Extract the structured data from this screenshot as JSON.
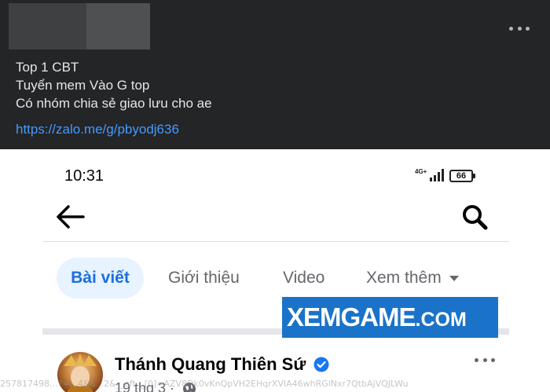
{
  "post": {
    "lines": [
      "Top 1 CBT",
      "Tuyển mem Vào G top",
      "Có nhóm chia sẻ giao lưu cho ae"
    ],
    "link": "https://zalo.me/g/pbyodj636",
    "avatar_state": "blurred",
    "more_icon": "more-horizontal-icon"
  },
  "phone": {
    "status": {
      "time": "10:31",
      "network": "4G+",
      "battery": "66"
    },
    "nav": {
      "back_icon": "back-arrow-icon",
      "search_icon": "search-icon"
    },
    "tabs": [
      {
        "label": "Bài viết",
        "active": true
      },
      {
        "label": "Giới thiệu",
        "active": false
      },
      {
        "label": "Video",
        "active": false
      },
      {
        "label": "Xem thêm",
        "active": false
      }
    ],
    "page": {
      "name": "Thánh Quang Thiên Sứ",
      "verified": true,
      "date": "19 thg 3 ·",
      "audience_icon": "globe-icon"
    }
  },
  "watermark": {
    "main": "XEMGAME",
    "suffix": ".COM"
  },
  "url_overlay": "257817498...?=...4&6...2&__cft__[0]=AZV8Dk0vKnQpVH2EHqrXVIA46whRGlNxr7QtbAjVQJLWu"
}
